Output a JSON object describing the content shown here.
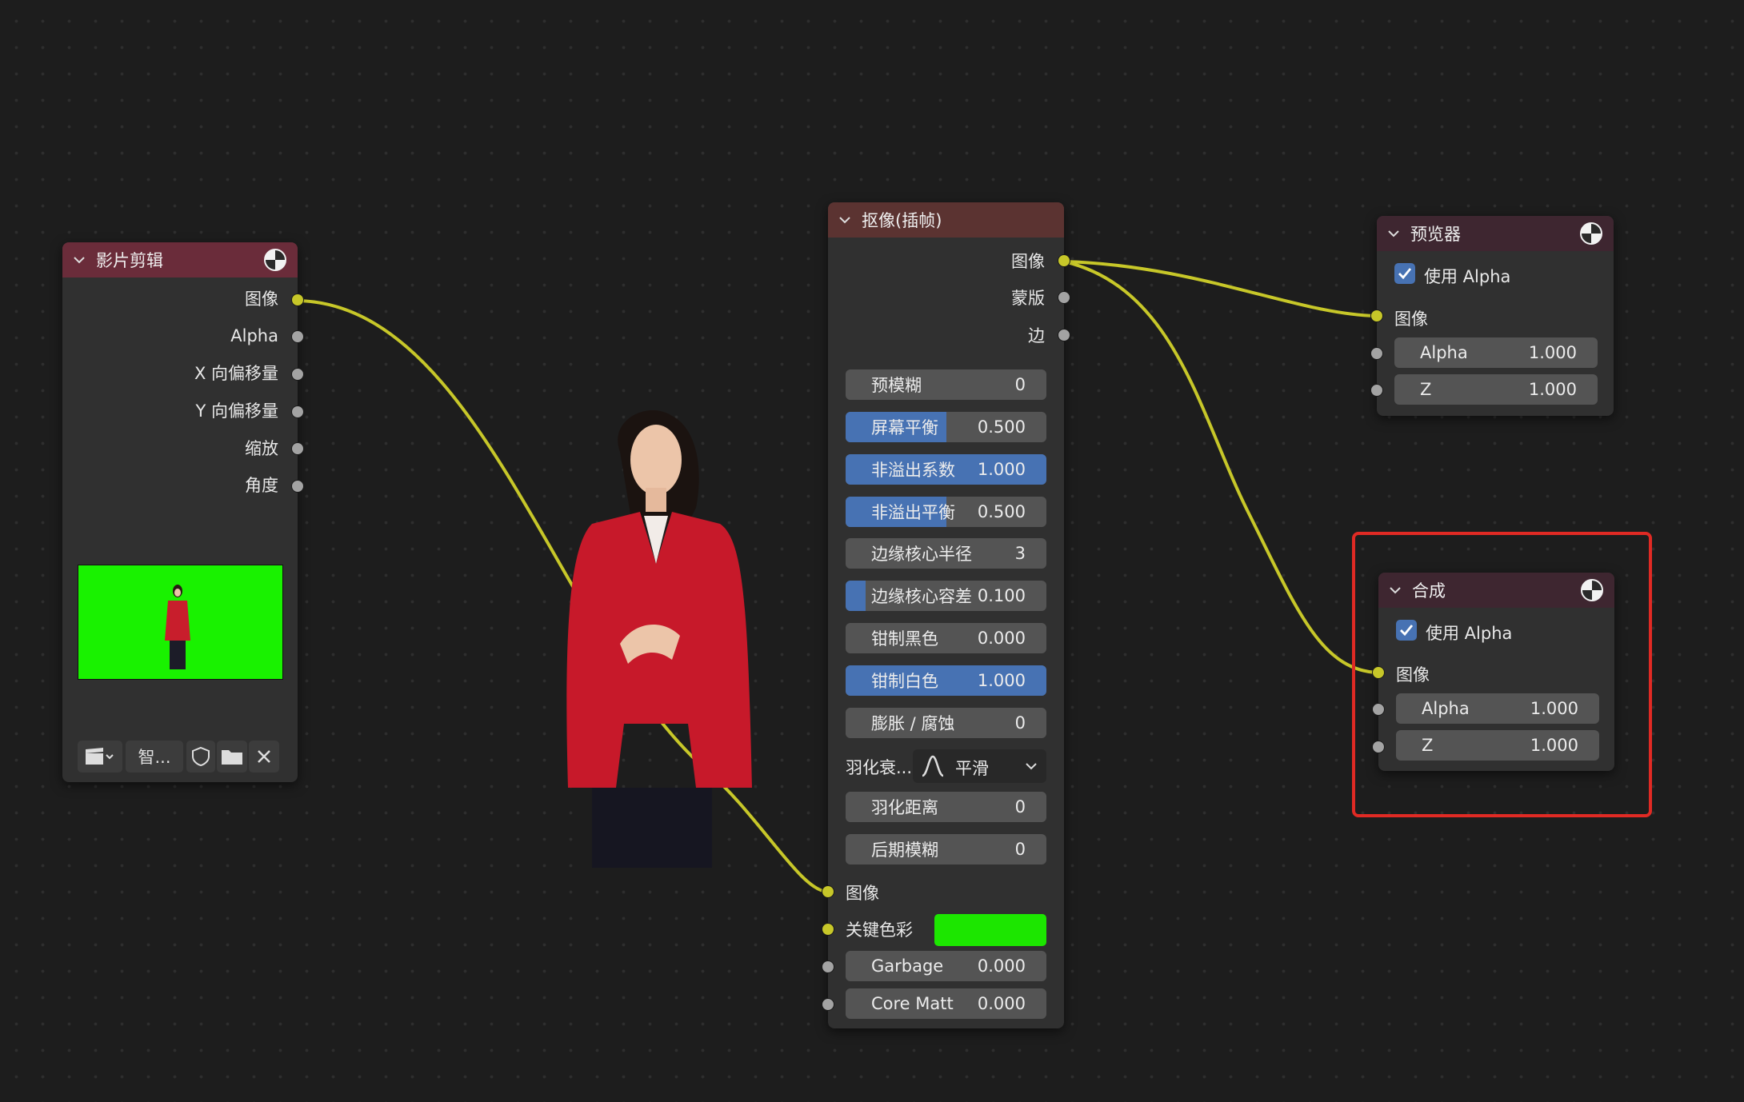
{
  "canvas": {
    "background": "#1d1d1d",
    "link_color": "#c7c729"
  },
  "movie_clip_node": {
    "title": "影片剪辑",
    "outputs": [
      "图像",
      "Alpha",
      "X 向偏移量",
      "Y 向偏移量",
      "缩放",
      "角度"
    ],
    "clip_name": "智...",
    "thumbnail_bg": "#19f200"
  },
  "keying_node": {
    "title": "抠像(插帧)",
    "outputs": [
      "图像",
      "蒙版",
      "边"
    ],
    "fields": [
      {
        "label": "预模糊",
        "value": "0",
        "fill": 0
      },
      {
        "label": "屏幕平衡",
        "value": "0.500",
        "fill": 0.5
      },
      {
        "label": "非溢出系数",
        "value": "1.000",
        "fill": 1.0
      },
      {
        "label": "非溢出平衡",
        "value": "0.500",
        "fill": 0.5
      },
      {
        "label": "边缘核心半径",
        "value": "3",
        "fill": 0
      },
      {
        "label": "边缘核心容差",
        "value": "0.100",
        "fill": 0.1
      },
      {
        "label": "钳制黑色",
        "value": "0.000",
        "fill": 0
      },
      {
        "label": "钳制白色",
        "value": "1.000",
        "fill": 1.0
      },
      {
        "label": "膨胀 / 腐蚀",
        "value": "0",
        "fill": 0
      }
    ],
    "feather_falloff_label": "羽化衰...",
    "feather_falloff_value": "平滑",
    "fields2": [
      {
        "label": "羽化距离",
        "value": "0"
      },
      {
        "label": "后期模糊",
        "value": "0"
      }
    ],
    "inputs": {
      "image": "图像",
      "key_color": "关键色彩",
      "key_color_value": "#1ce600",
      "garbage_label": "Garbage",
      "garbage_value": "0.000",
      "core_label": "Core Matt",
      "core_value": "0.000"
    }
  },
  "viewer_node": {
    "title": "预览器",
    "use_alpha": "使用 Alpha",
    "input_image": "图像",
    "alpha_label": "Alpha",
    "alpha_value": "1.000",
    "z_label": "Z",
    "z_value": "1.000"
  },
  "composite_node": {
    "title": "合成",
    "use_alpha": "使用 Alpha",
    "input_image": "图像",
    "alpha_label": "Alpha",
    "alpha_value": "1.000",
    "z_label": "Z",
    "z_value": "1.000",
    "highlight_color": "#e02a24"
  }
}
